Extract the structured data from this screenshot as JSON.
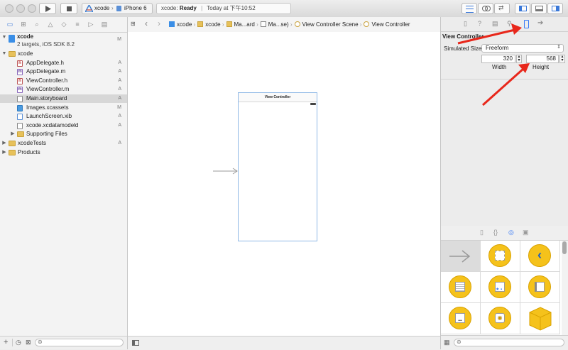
{
  "toolbar": {
    "scheme_name": "xcode",
    "device": "iPhone 6",
    "status_app": "xcode",
    "status_text": "Ready",
    "status_time": "Today at 下午10:52"
  },
  "navigator": {
    "project": {
      "name": "xcode",
      "subtitle": "2 targets, iOS SDK 8.2",
      "badge": "M"
    },
    "items": [
      {
        "label": "xcode",
        "badge": "",
        "icon": "folder-icon",
        "level": 1,
        "disclosure": "open"
      },
      {
        "label": "AppDelegate.h",
        "badge": "A",
        "icon": "header-file-icon",
        "level": 2
      },
      {
        "label": "AppDelegate.m",
        "badge": "A",
        "icon": "implementation-file-icon",
        "level": 2
      },
      {
        "label": "ViewController.h",
        "badge": "A",
        "icon": "header-file-icon",
        "level": 2
      },
      {
        "label": "ViewController.m",
        "badge": "A",
        "icon": "implementation-file-icon",
        "level": 2
      },
      {
        "label": "Main.storyboard",
        "badge": "A",
        "icon": "storyboard-file-icon",
        "level": 2,
        "selected": true
      },
      {
        "label": "Images.xcassets",
        "badge": "M",
        "icon": "asset-catalog-icon",
        "level": 2
      },
      {
        "label": "LaunchScreen.xib",
        "badge": "A",
        "icon": "xib-file-icon",
        "level": 2
      },
      {
        "label": "xcode.xcdatamodeld",
        "badge": "A",
        "icon": "data-model-icon",
        "level": 2
      },
      {
        "label": "Supporting Files",
        "badge": "",
        "icon": "folder-icon",
        "level": 2,
        "disclosure": "closed"
      },
      {
        "label": "xcodeTests",
        "badge": "A",
        "icon": "folder-icon",
        "level": 1,
        "disclosure": "closed"
      },
      {
        "label": "Products",
        "badge": "",
        "icon": "folder-icon",
        "level": 1,
        "disclosure": "closed"
      }
    ]
  },
  "jumpbar": {
    "crumbs": [
      "xcode",
      "xcode",
      "Ma...ard",
      "Ma...se)",
      "View Controller Scene",
      "View Controller"
    ]
  },
  "scene": {
    "title": "View Controller"
  },
  "inspector": {
    "section_title": "View Controller",
    "simulated_size_label": "Simulated Size",
    "simulated_size_value": "Freeform",
    "width_value": "320",
    "height_value": "568",
    "width_label": "Width",
    "height_label": "Height"
  },
  "colors": {
    "annotation_arrow": "#e8271b",
    "selection_blue": "#3478f6",
    "object_yellow": "#f5c21b"
  }
}
